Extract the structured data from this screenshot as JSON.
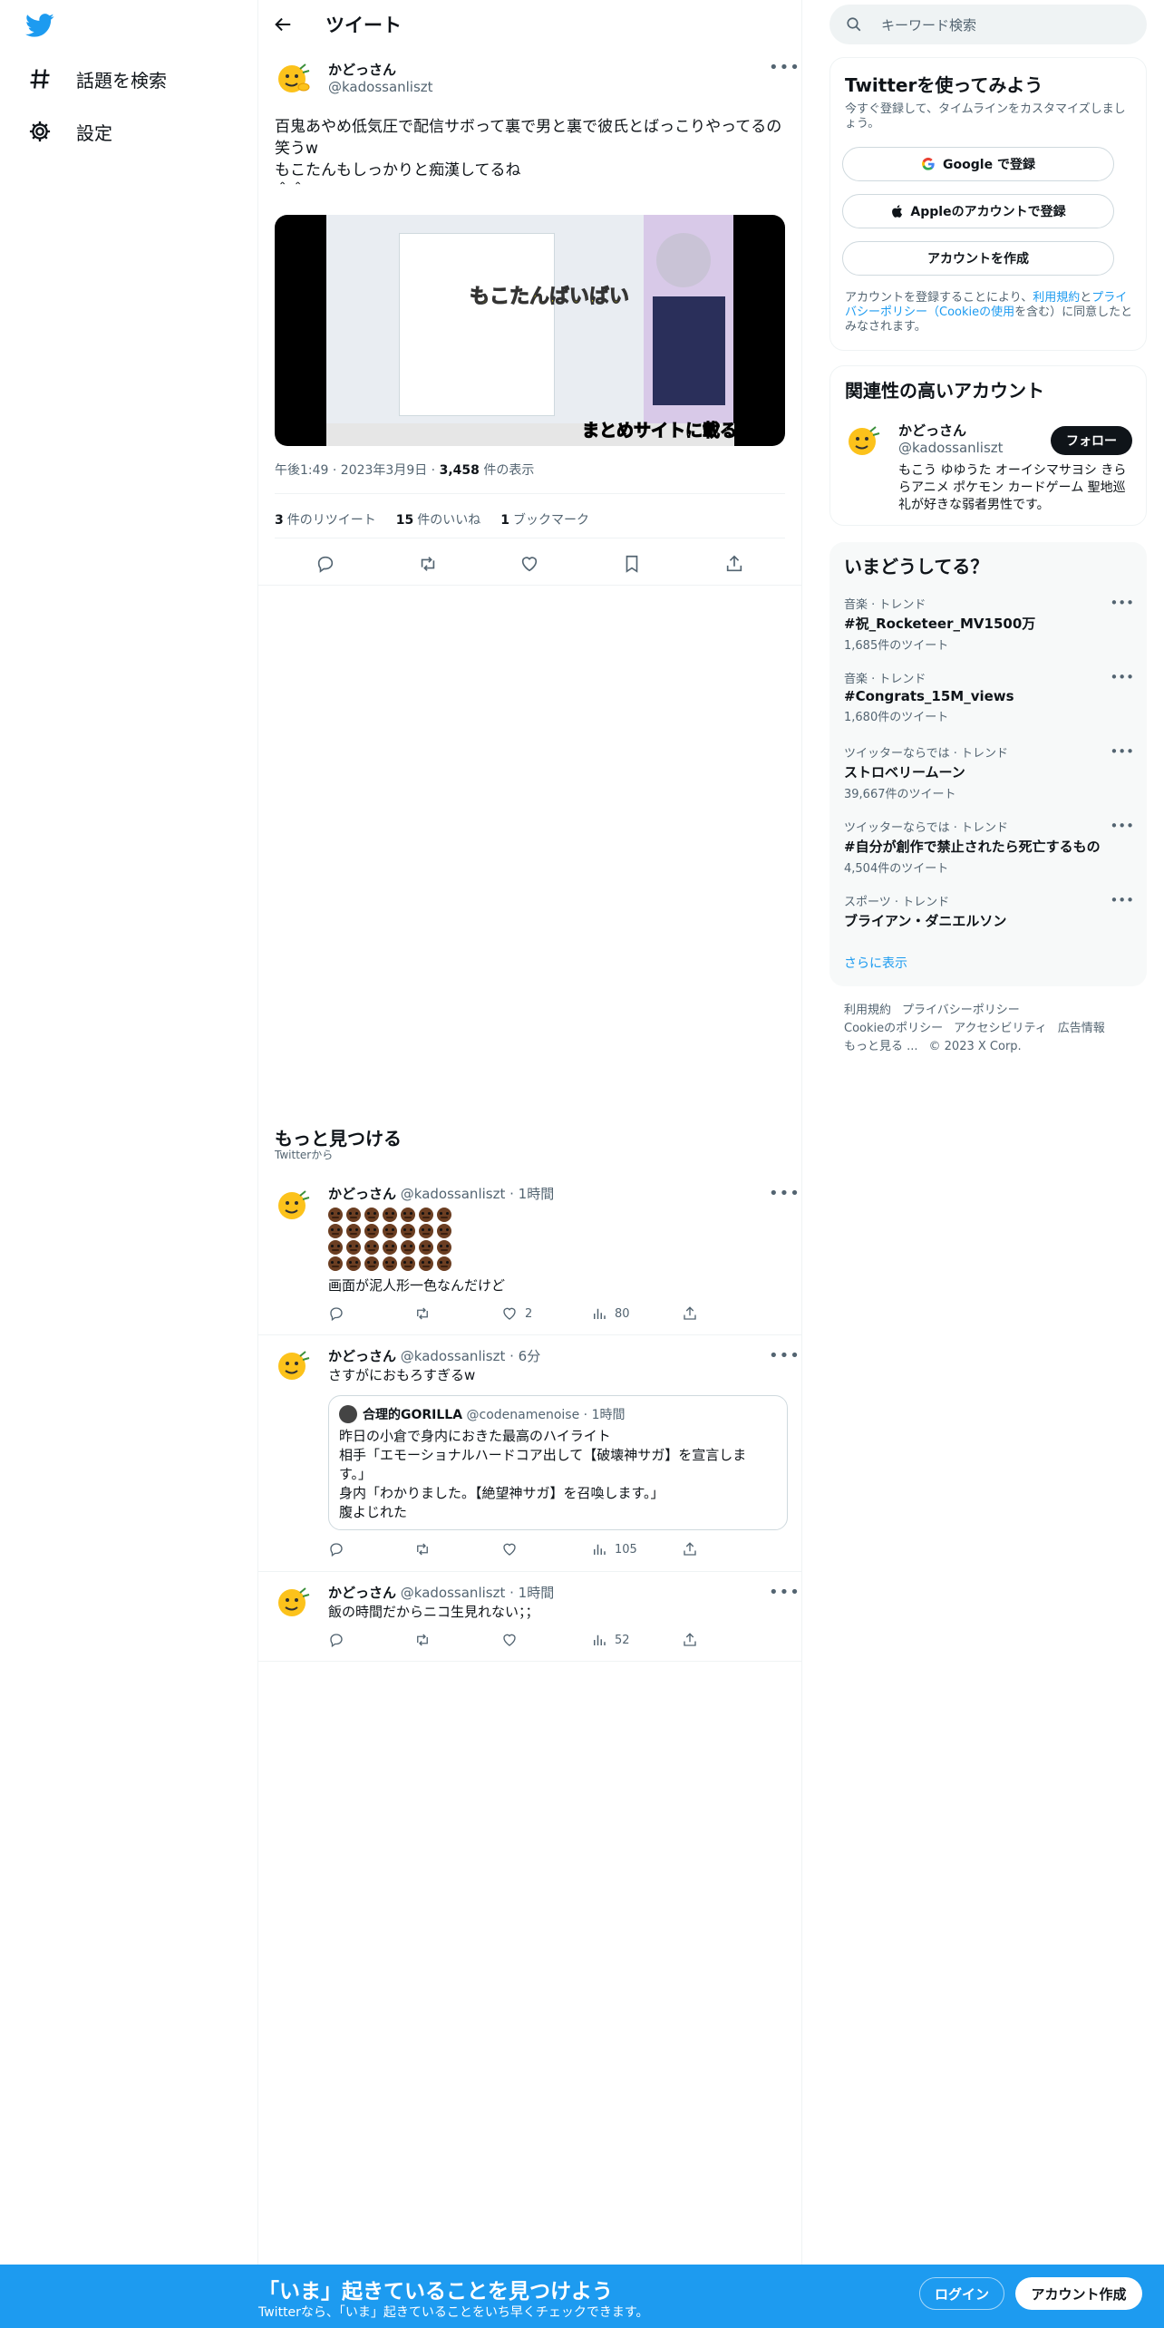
{
  "nav": {
    "explore_label": "話題を検索",
    "settings_label": "設定"
  },
  "header": {
    "title": "ツイート"
  },
  "main_tweet": {
    "author_name": "かどっさん",
    "author_handle": "@kadossanliszt",
    "text": "百鬼あやめ低気圧で配信サボって裏で男と裏で彼氏とばっこりやってるの笑うw\nもこたんもしっかりと痴漢してるね\n＾＾",
    "media_caption_1": "もこたんばいばい",
    "media_caption_2": "まとめサイトに載る",
    "time": "午後1:49 · 2023年3月9日 · ",
    "views_count": "3,458",
    "views_label": " 件の表示",
    "retweets_count": "3",
    "retweets_label": "件のリツイート",
    "likes_count": "15",
    "likes_label": "件のいいね",
    "bookmarks_count": "1",
    "bookmarks_label": "ブックマーク"
  },
  "more": {
    "title": "もっと見つける",
    "subtitle": "Twitterから"
  },
  "feed": [
    {
      "name": "かどっさん",
      "handle": "@kadossanliszt",
      "time": "· 1時間",
      "text": "画面が泥人形一色なんだけど",
      "likes": "2",
      "views": "80"
    },
    {
      "name": "かどっさん",
      "handle": "@kadossanliszt",
      "time": "· 6分",
      "text": "さすがにおもろすぎるw",
      "quote_name": "合理的GORILLA",
      "quote_handle": "@codenamenoise",
      "quote_time": "· 1時間",
      "quote_text": "昨日の小倉で身内におきた最高のハイライト\n相手「エモーショナルハードコア出して【破壊神サガ】を宣言します。」\n身内「わかりました。【絶望神サガ】を召喚します。」\n腹よじれた",
      "views": "105"
    },
    {
      "name": "かどっさん",
      "handle": "@kadossanliszt",
      "time": "· 1時間",
      "text": "飯の時間だからニコ生見れない；；",
      "views": "52"
    }
  ],
  "search": {
    "placeholder": "キーワード検索"
  },
  "signup_card": {
    "title": "Twitterを使ってみよう",
    "desc": "今すぐ登録して、タイムラインをカスタマイズしましょう。",
    "google": "Google で登録",
    "apple": "Appleのアカウントで登録",
    "create": "アカウントを作成",
    "terms_1": "アカウントを登録することにより、",
    "terms_link1": "利用規約",
    "terms_2": "と",
    "terms_link2": "プライバシーポリシー（Cookieの使用",
    "terms_3": "を含む）に同意したとみなされます。"
  },
  "related": {
    "title": "関連性の高いアカウント",
    "name": "かどっさん",
    "handle": "@kadossanliszt",
    "follow": "フォロー",
    "bio": "もこう ゆゆうた オーイシマサヨシ きららアニメ ポケモン カードゲーム 聖地巡礼が好きな弱者男性です。"
  },
  "trends": {
    "title": "いまどうしてる？",
    "items": [
      {
        "context": "音楽 · トレンド",
        "name": "#祝_Rocketeer_MV1500万",
        "count": "1,685件のツイート"
      },
      {
        "context": "音楽 · トレンド",
        "name": "#Congrats_15M_views",
        "count": "1,680件のツイート"
      },
      {
        "context": "ツイッターならでは · トレンド",
        "name": "ストロベリームーン",
        "count": "39,667件のツイート"
      },
      {
        "context": "ツイッターならでは · トレンド",
        "name": "#自分が創作で禁止されたら死亡するもの",
        "count": "4,504件のツイート"
      },
      {
        "context": "スポーツ · トレンド",
        "name": "ブライアン・ダニエルソン",
        "count": ""
      }
    ],
    "show_more": "さらに表示"
  },
  "footer": {
    "terms": "利用規約",
    "privacy": "プライバシーポリシー",
    "cookie": "Cookieのポリシー",
    "accessibility": "アクセシビリティ",
    "ads": "広告情報",
    "more": "もっと見る ...",
    "copyright": "© 2023 X Corp."
  },
  "bottom_bar": {
    "title": "「いま」起きていることを見つけよう",
    "subtitle": "Twitterなら、「いま」起きていることをいち早くチェックできます。",
    "login": "ログイン",
    "signup": "アカウント作成"
  },
  "colors": {
    "accent": "#1d9bf0",
    "text": "#0f1419",
    "muted": "#536471"
  }
}
